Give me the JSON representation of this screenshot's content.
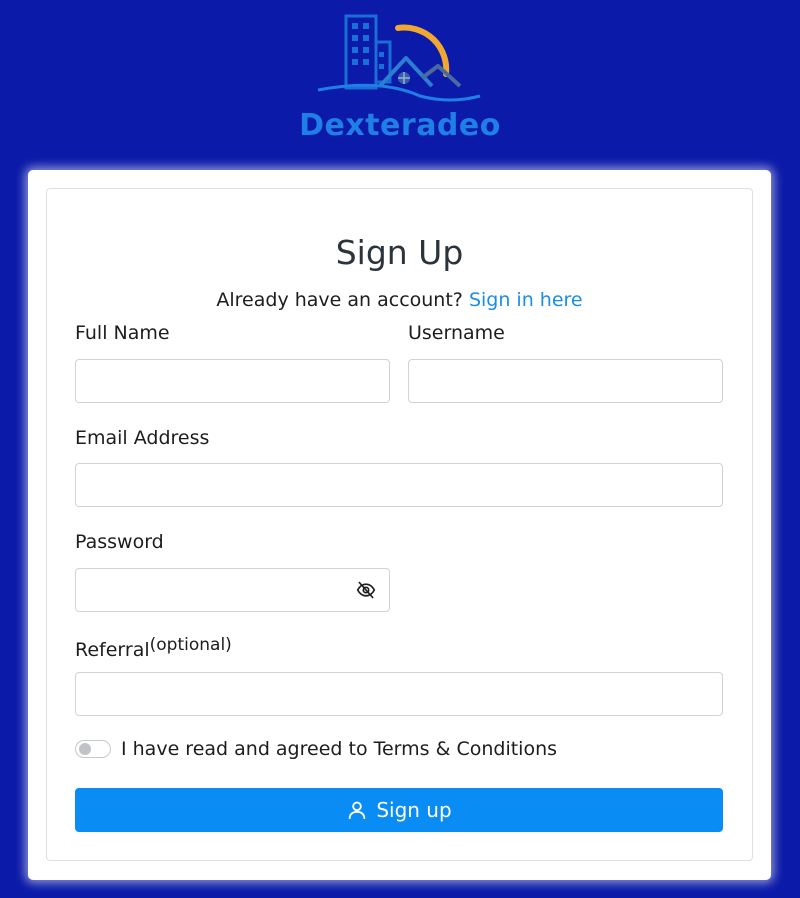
{
  "brand": {
    "name": "Dexteradeo",
    "logo_icon": "building-house-sun-logo"
  },
  "form": {
    "title": "Sign Up",
    "signin_prompt": "Already have an account?",
    "signin_link": "Sign in here",
    "fields": {
      "full_name": {
        "label": "Full Name",
        "value": "",
        "placeholder": ""
      },
      "username": {
        "label": "Username",
        "value": "",
        "placeholder": ""
      },
      "email": {
        "label": "Email Address",
        "value": "",
        "placeholder": ""
      },
      "password": {
        "label": "Password",
        "value": "",
        "placeholder": "",
        "toggle_icon": "eye-off-icon"
      },
      "referral": {
        "label": "Referral",
        "label_suffix": "(optional)",
        "value": "",
        "placeholder": ""
      }
    },
    "terms": {
      "label": "I have read and agreed to Terms & Conditions",
      "checked": false
    },
    "submit": {
      "label": "Sign up",
      "icon": "user-icon"
    }
  },
  "colors": {
    "background": "#0b1aa8",
    "primary": "#0a8cf5",
    "link": "#1a8ee6",
    "brand_text": "#1f7fe6",
    "logo_sun": "#f0a830"
  }
}
